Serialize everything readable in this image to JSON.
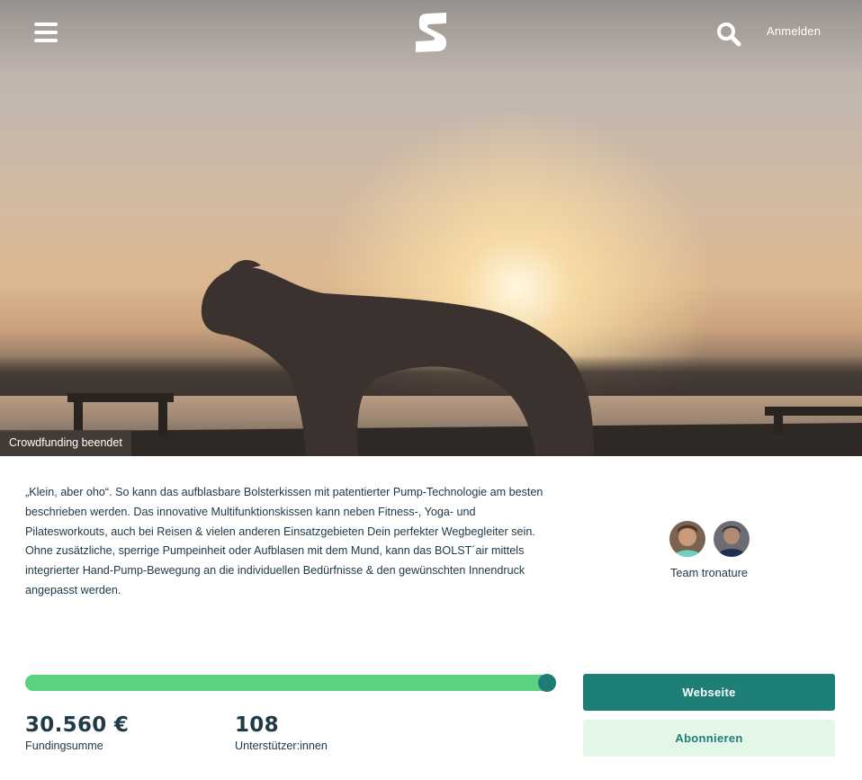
{
  "header": {
    "login_label": "Anmelden",
    "icons": [
      "menu-icon",
      "logo-icon",
      "search-icon"
    ]
  },
  "hero": {
    "status_badge": "Crowdfunding beendet"
  },
  "project": {
    "description": "„Klein, aber oho“. So kann das aufblasbare Bolsterkissen mit patentierter Pump-Technologie am besten beschrieben werden. Das innovative Multifunktionskissen kann neben Fitness-, Yoga- und Pilatesworkouts, auch bei Reisen & vielen anderen Einsatzgebieten Dein perfekter Wegbegleiter sein. Ohne zusätzliche, sperrige Pumpeinheit oder Aufblasen mit dem Mund, kann das BOLST´air mittels integrierter Hand-Pump-Bewegung an die individuellen Bedürfnisse & den gewünschten Innendruck angepasst werden."
  },
  "team": {
    "name": "Team tronature",
    "member_count": 2
  },
  "funding": {
    "progress_fraction": 1.0,
    "amount": "30.560 €",
    "amount_label": "Fundingsumme",
    "supporters": "108",
    "supporters_label": "Unterstützer:innen"
  },
  "actions": {
    "website_label": "Webseite",
    "subscribe_label": "Abonnieren"
  },
  "colors": {
    "brand_dark": "#1e7f76",
    "progress_green": "#5bd27f",
    "text": "#213a48"
  }
}
